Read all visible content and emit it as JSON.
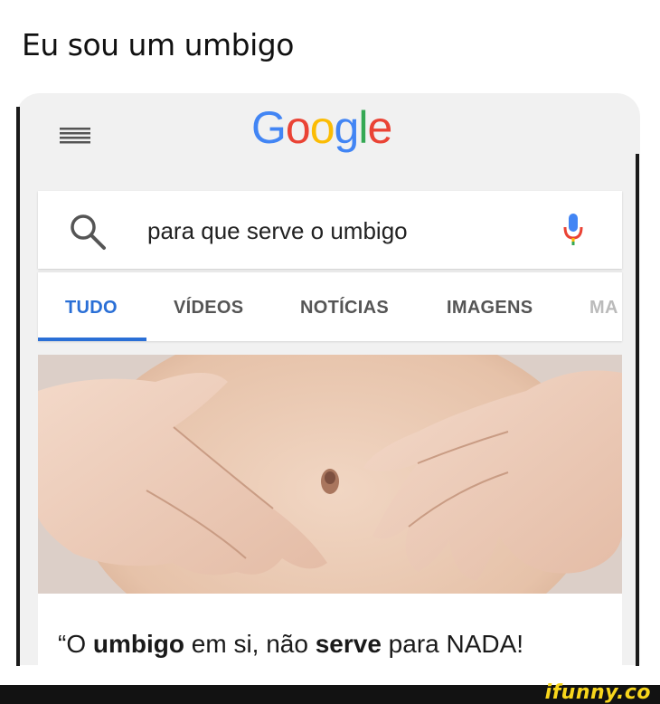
{
  "caption": "Eu sou um umbigo",
  "header": {
    "menu_icon": "hamburger-menu-icon",
    "logo": [
      "G",
      "o",
      "o",
      "g",
      "l",
      "e"
    ],
    "logo_colors": [
      "#4285F4",
      "#EA4335",
      "#FBBC05",
      "#4285F4",
      "#34A853",
      "#EA4335"
    ]
  },
  "search": {
    "icon": "search-icon",
    "query": "para que serve o umbigo",
    "mic_icon": "microphone-icon"
  },
  "tabs": [
    {
      "label": "TUDO",
      "active": true
    },
    {
      "label": "VÍDEOS",
      "active": false
    },
    {
      "label": "NOTÍCIAS",
      "active": false
    },
    {
      "label": "IMAGENS",
      "active": false
    },
    {
      "label": "MA",
      "active": false
    }
  ],
  "colors": {
    "accent": "#2a6fd6",
    "skin": "#e9c9b4"
  },
  "result": {
    "open_quote": "“O ",
    "bold1": "umbigo",
    "mid": " em si, não ",
    "bold2": "serve",
    "end": " para NADA!"
  },
  "watermark": "ifunny.co"
}
